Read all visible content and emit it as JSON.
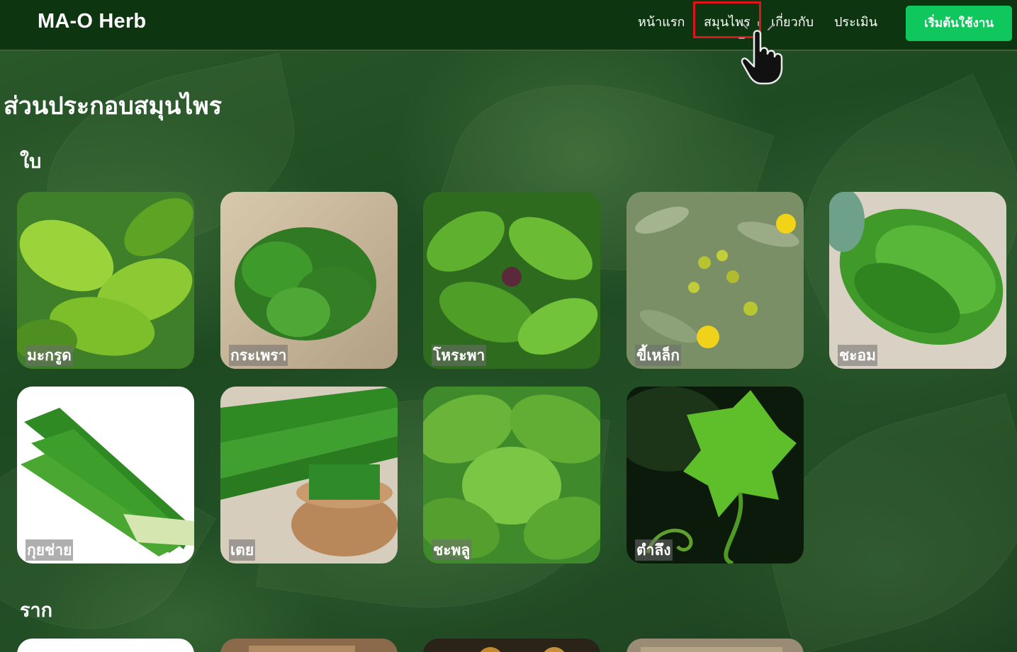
{
  "navbar": {
    "brand": "MA-O Herb",
    "links": [
      "หน้าแรก",
      "สมุนไพร",
      "เกี่ยวกับ",
      "ประเมิน"
    ],
    "active_link": "สมุนไพร",
    "cta_label": "เริ่มต้นใช้งาน"
  },
  "page": {
    "title": "ส่วนประกอบสมุนไพร"
  },
  "sections": {
    "leaf": {
      "title": "ใบ",
      "herbs": [
        "มะกรูด",
        "กระเพรา",
        "โหระพา",
        "ขี้เหล็ก",
        "ชะอม",
        "กุยช่าย",
        "เตย",
        "ชะพลู",
        "ตำลึง"
      ]
    },
    "root": {
      "title": "ราก"
    }
  },
  "colors": {
    "navbar_bg": "#0d3510",
    "cta_bg": "#10c75e",
    "highlight_border": "#e0141a",
    "page_bg": "#1f4a23"
  }
}
